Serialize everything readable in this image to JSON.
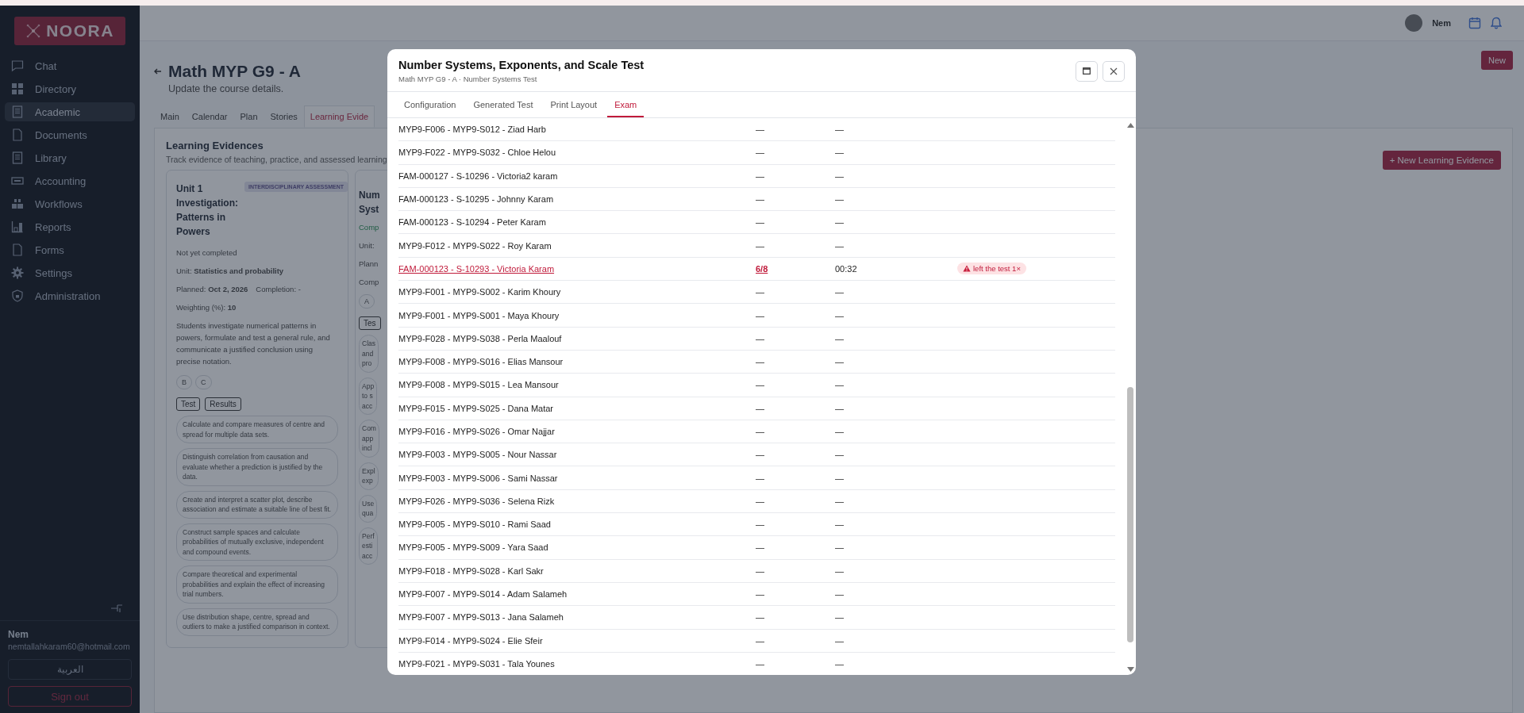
{
  "sidebar": {
    "logo": "NOORA",
    "items": [
      {
        "label": "Chat",
        "selected": false
      },
      {
        "label": "Directory",
        "selected": false
      },
      {
        "label": "Academic",
        "selected": true
      },
      {
        "label": "Documents",
        "selected": false
      },
      {
        "label": "Library",
        "selected": false
      },
      {
        "label": "Accounting",
        "selected": false
      },
      {
        "label": "Workflows",
        "selected": false
      },
      {
        "label": "Reports",
        "selected": false
      },
      {
        "label": "Forms",
        "selected": false
      },
      {
        "label": "Settings",
        "selected": false
      },
      {
        "label": "Administration",
        "selected": false
      }
    ],
    "user": {
      "name": "Nem",
      "email": "nemtallahkaram60@hotmail.com"
    },
    "language_button": "العربية",
    "sign_out": "Sign out"
  },
  "topbar": {
    "user": "Nem"
  },
  "page": {
    "title": "Math MYP G9 - A",
    "subtitle": "Update the course details.",
    "new_button": "New",
    "tabs": [
      {
        "label": "Main",
        "selected": false
      },
      {
        "label": "Calendar",
        "selected": false
      },
      {
        "label": "Plan",
        "selected": false
      },
      {
        "label": "Stories",
        "selected": false
      },
      {
        "label": "Learning Evide",
        "selected": true
      }
    ],
    "section_title": "Learning Evidences",
    "section_subtitle": "Track evidence of teaching, practice, and assessed learning",
    "add_button": "+ New Learning Evidence",
    "cards": [
      {
        "title": "Unit 1 Investigation: Patterns in Powers",
        "badge": "INTERDISCIPLINARY ASSESSMENT",
        "status": "Not yet completed",
        "unit_label": "Unit:",
        "unit": "Statistics and probability",
        "planned_label": "Planned:",
        "planned": "Oct 2, 2026",
        "completion": "Completion: -",
        "weighting_label": "Weighting (%):",
        "weighting": "10",
        "description": "Students investigate numerical patterns in powers, formulate and test a general rule, and communicate a justified conclusion using precise notation.",
        "criteria": [
          "B",
          "C"
        ],
        "buttons": [
          "Test",
          "Results"
        ],
        "objectives": [
          "Calculate and compare measures of centre and spread for multiple data sets.",
          "Distinguish correlation from causation and evaluate whether a prediction is justified by the data.",
          "Create and interpret a scatter plot, describe association and estimate a suitable line of best fit.",
          "Construct sample spaces and calculate probabilities of mutually exclusive, independent and compound events.",
          "Compare theoretical and experimental probabilities and explain the effect of increasing trial numbers.",
          "Use distribution shape, centre, spread and outliers to make a justified comparison in context."
        ]
      },
      {
        "title": "Num Syst",
        "status": "Comp",
        "unit_label": "Unit:",
        "planned_label": "Plann",
        "completion": "Comp",
        "criteria": [
          "A"
        ],
        "buttons": [
          "Tes"
        ],
        "objectives": [
          "Clas and pro",
          "App to s acc",
          "Com app incl",
          "Expl exp",
          "Use qua",
          "Perf esti acc"
        ]
      }
    ]
  },
  "modal": {
    "title": "Number Systems, Exponents, and Scale Test",
    "subtitle": "Math MYP G9 - A · Number Systems Test",
    "tabs": [
      {
        "label": "Configuration",
        "selected": false
      },
      {
        "label": "Generated Test",
        "selected": false
      },
      {
        "label": "Print Layout",
        "selected": false
      },
      {
        "label": "Exam",
        "selected": true
      }
    ],
    "rows": [
      {
        "student": "MYP9-F006 - MYP9-S012 - Ziad Harb",
        "score": "—",
        "time": "—",
        "kind": "pending"
      },
      {
        "student": "MYP9-F022 - MYP9-S032 - Chloe Helou",
        "score": "—",
        "time": "—",
        "kind": "pending"
      },
      {
        "student": "FAM-000127 - S-10296 - Victoria2 karam",
        "score": "—",
        "time": "—",
        "kind": "pending"
      },
      {
        "student": "FAM-000123 - S-10295 - Johnny Karam",
        "score": "—",
        "time": "—",
        "kind": "pending"
      },
      {
        "student": "FAM-000123 - S-10294 - Peter Karam",
        "score": "—",
        "time": "—",
        "kind": "pending"
      },
      {
        "student": "MYP9-F012 - MYP9-S022 - Roy Karam",
        "score": "—",
        "time": "—",
        "kind": "pending"
      },
      {
        "student": "FAM-000123 - S-10293 - Victoria Karam",
        "score": "6/8",
        "time": "00:32",
        "kind": "submitted",
        "flag": "left the test 1×"
      },
      {
        "student": "MYP9-F001 - MYP9-S002 - Karim Khoury",
        "score": "—",
        "time": "—",
        "kind": "pending"
      },
      {
        "student": "MYP9-F001 - MYP9-S001 - Maya Khoury",
        "score": "—",
        "time": "—",
        "kind": "pending"
      },
      {
        "student": "MYP9-F028 - MYP9-S038 - Perla Maalouf",
        "score": "—",
        "time": "—",
        "kind": "pending"
      },
      {
        "student": "MYP9-F008 - MYP9-S016 - Elias Mansour",
        "score": "—",
        "time": "—",
        "kind": "pending"
      },
      {
        "student": "MYP9-F008 - MYP9-S015 - Lea Mansour",
        "score": "—",
        "time": "—",
        "kind": "pending"
      },
      {
        "student": "MYP9-F015 - MYP9-S025 - Dana Matar",
        "score": "—",
        "time": "—",
        "kind": "pending"
      },
      {
        "student": "MYP9-F016 - MYP9-S026 - Omar Najjar",
        "score": "—",
        "time": "—",
        "kind": "pending"
      },
      {
        "student": "MYP9-F003 - MYP9-S005 - Nour Nassar",
        "score": "—",
        "time": "—",
        "kind": "pending"
      },
      {
        "student": "MYP9-F003 - MYP9-S006 - Sami Nassar",
        "score": "—",
        "time": "—",
        "kind": "pending"
      },
      {
        "student": "MYP9-F026 - MYP9-S036 - Selena Rizk",
        "score": "—",
        "time": "—",
        "kind": "pending"
      },
      {
        "student": "MYP9-F005 - MYP9-S010 - Rami Saad",
        "score": "—",
        "time": "—",
        "kind": "pending"
      },
      {
        "student": "MYP9-F005 - MYP9-S009 - Yara Saad",
        "score": "—",
        "time": "—",
        "kind": "pending"
      },
      {
        "student": "MYP9-F018 - MYP9-S028 - Karl Sakr",
        "score": "—",
        "time": "—",
        "kind": "pending"
      },
      {
        "student": "MYP9-F007 - MYP9-S014 - Adam Salameh",
        "score": "—",
        "time": "—",
        "kind": "pending"
      },
      {
        "student": "MYP9-F007 - MYP9-S013 - Jana Salameh",
        "score": "—",
        "time": "—",
        "kind": "pending"
      },
      {
        "student": "MYP9-F014 - MYP9-S024 - Elie Sfeir",
        "score": "—",
        "time": "—",
        "kind": "pending"
      },
      {
        "student": "MYP9-F021 - MYP9-S031 - Tala Younes",
        "score": "—",
        "time": "—",
        "kind": "pending"
      }
    ]
  }
}
